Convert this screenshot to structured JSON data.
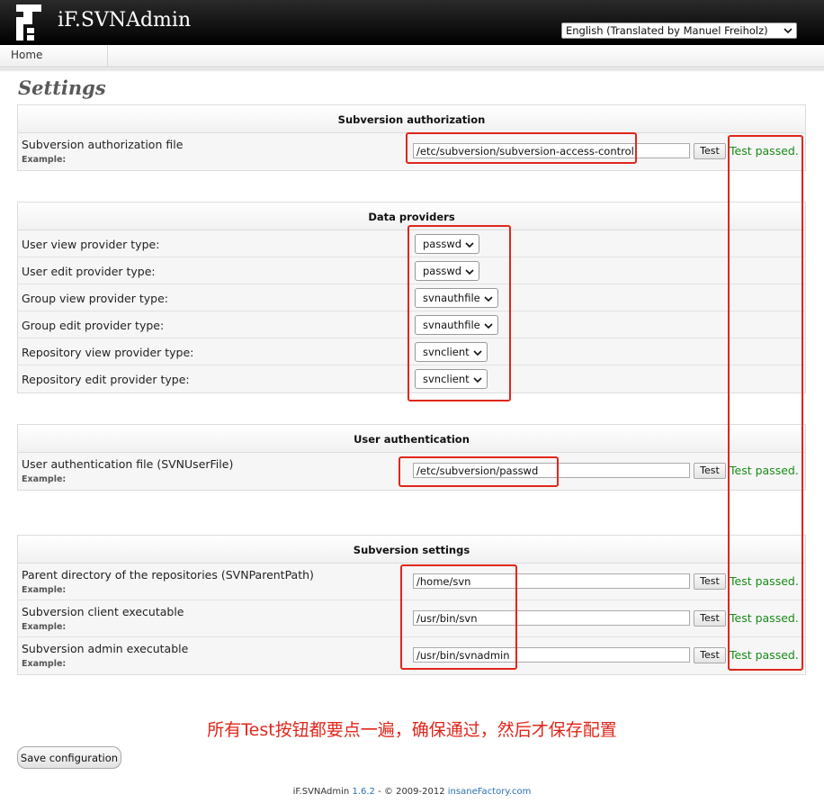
{
  "header": {
    "brand": "iF.SVNAdmin",
    "language": "English (Translated by Manuel Freiholz)"
  },
  "nav": {
    "home": "Home"
  },
  "page": {
    "title": "Settings"
  },
  "sections": {
    "auth": {
      "title": "Subversion authorization",
      "rows": [
        {
          "label": "Subversion authorization file",
          "example": "Example:",
          "value": "/etc/subversion/subversion-access-control",
          "test": "Test",
          "status": "Test passed."
        }
      ]
    },
    "providers": {
      "title": "Data providers",
      "rows": [
        {
          "label": "User view provider type:",
          "value": "passwd"
        },
        {
          "label": "User edit provider type:",
          "value": "passwd"
        },
        {
          "label": "Group view provider type:",
          "value": "svnauthfile"
        },
        {
          "label": "Group edit provider type:",
          "value": "svnauthfile"
        },
        {
          "label": "Repository view provider type:",
          "value": "svnclient"
        },
        {
          "label": "Repository edit provider type:",
          "value": "svnclient"
        }
      ]
    },
    "userauth": {
      "title": "User authentication",
      "rows": [
        {
          "label": "User authentication file (SVNUserFile)",
          "example": "Example:",
          "value": "/etc/subversion/passwd",
          "test": "Test",
          "status": "Test passed."
        }
      ]
    },
    "svn": {
      "title": "Subversion settings",
      "rows": [
        {
          "label": "Parent directory of the repositories (SVNParentPath)",
          "example": "Example:",
          "value": "/home/svn",
          "test": "Test",
          "status": "Test passed."
        },
        {
          "label": "Subversion client executable",
          "example": "Example:",
          "value": "/usr/bin/svn",
          "test": "Test",
          "status": "Test passed."
        },
        {
          "label": "Subversion admin executable",
          "example": "Example:",
          "value": "/usr/bin/svnadmin",
          "test": "Test",
          "status": "Test passed."
        }
      ]
    }
  },
  "annotation": {
    "note": "所有Test按钮都要点一遍，确保通过，然后才保存配置",
    "color": "#e0261b"
  },
  "actions": {
    "save": "Save configuration"
  },
  "footer": {
    "name": "iF.SVNAdmin",
    "version": "1.6.2",
    "copyright": "© 2009-2012",
    "vendor": "insaneFactory.com"
  },
  "colors": {
    "pass": "#1a8a1a",
    "header_bg": "#000000",
    "link": "#2a6fb0"
  }
}
